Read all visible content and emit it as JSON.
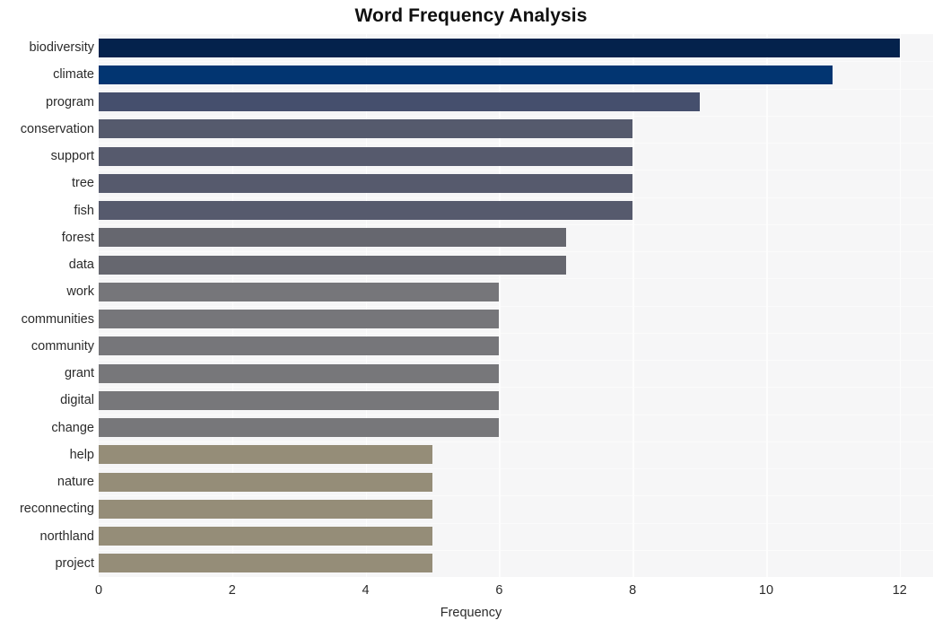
{
  "chart_data": {
    "type": "bar",
    "orientation": "horizontal",
    "title": "Word Frequency Analysis",
    "xlabel": "Frequency",
    "ylabel": "",
    "xlim": [
      0,
      12.5
    ],
    "xticks": [
      0,
      2,
      4,
      6,
      8,
      10,
      12
    ],
    "xticklabels": [
      "0",
      "2",
      "4",
      "6",
      "8",
      "10",
      "12"
    ],
    "grid": true,
    "legend": false,
    "categories": [
      "biodiversity",
      "climate",
      "program",
      "conservation",
      "support",
      "tree",
      "fish",
      "forest",
      "data",
      "work",
      "communities",
      "community",
      "grant",
      "digital",
      "change",
      "help",
      "nature",
      "reconnecting",
      "northland",
      "project"
    ],
    "values": [
      12,
      11,
      9,
      8,
      8,
      8,
      8,
      7,
      7,
      6,
      6,
      6,
      6,
      6,
      6,
      5,
      5,
      5,
      5,
      5
    ],
    "bar_colors": [
      "#04224c",
      "#023571",
      "#454f6d",
      "#555a6d",
      "#565a6d",
      "#565a6d",
      "#565a6d",
      "#66676f",
      "#66676f",
      "#76767a",
      "#76767a",
      "#76767a",
      "#77777a",
      "#77777a",
      "#77777a",
      "#958d78",
      "#958d78",
      "#958d78",
      "#958d78",
      "#958d78"
    ],
    "plot_background": "#f6f6f7",
    "gridline_color": "#fdfdfd",
    "figure_background": "#ffffff",
    "text_color": "#2b2b2b"
  }
}
